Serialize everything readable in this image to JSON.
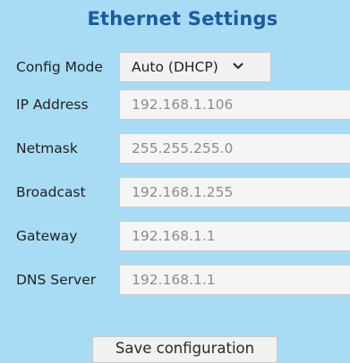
{
  "title": "Ethernet Settings",
  "config_mode": {
    "label": "Config Mode",
    "selected": "Auto (DHCP)"
  },
  "fields": [
    {
      "label": "IP Address",
      "value": "192.168.1.106"
    },
    {
      "label": "Netmask",
      "value": "255.255.255.0"
    },
    {
      "label": "Broadcast",
      "value": "192.168.1.255"
    },
    {
      "label": "Gateway",
      "value": "192.168.1.1"
    },
    {
      "label": "DNS Server",
      "value": "192.168.1.1"
    }
  ],
  "save_label": "Save configuration"
}
